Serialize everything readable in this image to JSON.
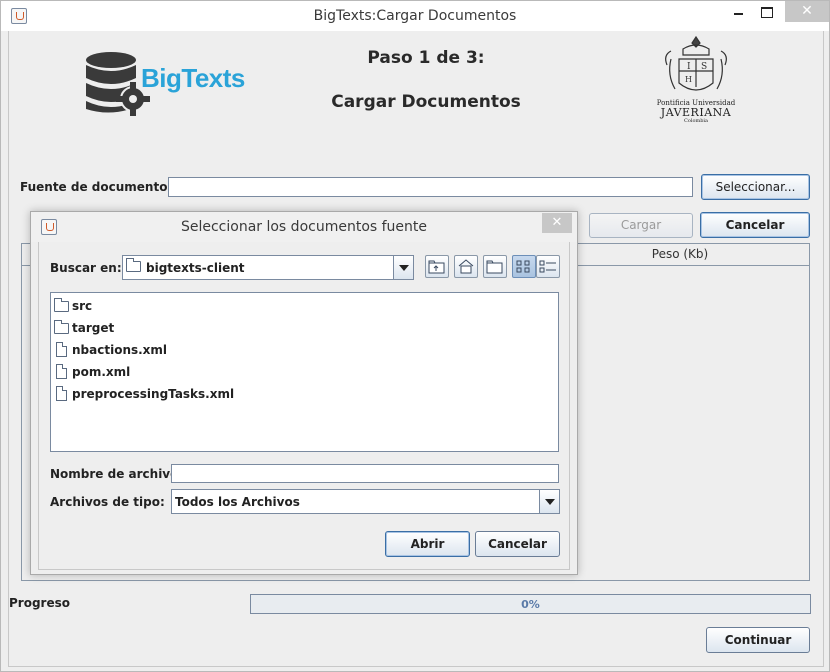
{
  "window": {
    "title": "BigTexts:Cargar Documentos",
    "controls": {
      "close": "✕"
    }
  },
  "header": {
    "logo_text": "BigTexts",
    "step_line1": "Paso 1 de 3:",
    "step_line2": "Cargar Documentos",
    "university_line1": "Pontificia Universidad",
    "university_line2": "JAVERIANA",
    "university_line3": "Colombia"
  },
  "source": {
    "label": "Fuente de documentos:",
    "value": "",
    "select_button": "Seleccionar..."
  },
  "actions": {
    "load_button": "Cargar",
    "cancel_button": "Cancelar"
  },
  "table": {
    "columns": [
      "",
      "Peso (Kb)"
    ]
  },
  "progress": {
    "label": "Progreso",
    "value": 0,
    "text": "0%"
  },
  "footer": {
    "continue_button": "Continuar"
  },
  "dialog": {
    "title": "Seleccionar los documentos fuente",
    "close": "✕",
    "look_in_label": "Buscar en:",
    "look_in_value": "bigtexts-client",
    "toolbar_icons": [
      "up-folder-icon",
      "home-icon",
      "new-folder-icon",
      "list-view-icon",
      "details-view-icon"
    ],
    "files": [
      {
        "name": "src",
        "type": "folder"
      },
      {
        "name": "target",
        "type": "folder"
      },
      {
        "name": "nbactions.xml",
        "type": "file"
      },
      {
        "name": "pom.xml",
        "type": "file"
      },
      {
        "name": "preprocessingTasks.xml",
        "type": "file"
      }
    ],
    "filename_label": "Nombre de archivo:",
    "filename_value": "",
    "filetype_label": "Archivos de tipo:",
    "filetype_value": "Todos los Archivos",
    "open_button": "Abrir",
    "cancel_button": "Cancelar"
  }
}
